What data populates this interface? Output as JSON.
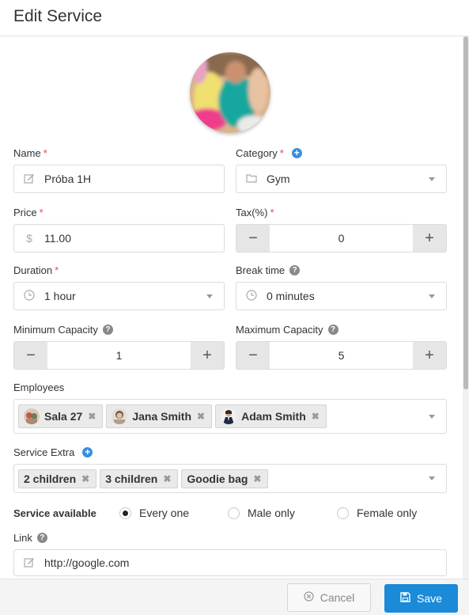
{
  "header": {
    "title": "Edit Service"
  },
  "colors": {
    "accent": "#1a8ad9",
    "required": "#ee4444",
    "help": "#888888"
  },
  "form": {
    "name": {
      "label": "Name",
      "value": "Próba 1H",
      "icon": "edit-icon"
    },
    "category": {
      "label": "Category",
      "value": "Gym",
      "icon": "folder-icon"
    },
    "price": {
      "label": "Price",
      "value": "11.00",
      "prefix": "$"
    },
    "tax": {
      "label": "Tax(%)",
      "value": "0"
    },
    "duration": {
      "label": "Duration",
      "value": "1 hour",
      "icon": "clock-icon"
    },
    "break_time": {
      "label": "Break time",
      "value": "0 minutes",
      "icon": "clock-icon"
    },
    "min_capacity": {
      "label": "Minimum Capacity",
      "value": "1"
    },
    "max_capacity": {
      "label": "Maximum Capacity",
      "value": "5"
    },
    "employees": {
      "label": "Employees",
      "items": [
        {
          "name": "Sala 27"
        },
        {
          "name": "Jana Smith"
        },
        {
          "name": "Adam Smith"
        }
      ]
    },
    "service_extra": {
      "label": "Service Extra",
      "items": [
        {
          "name": "2 children"
        },
        {
          "name": "3 children"
        },
        {
          "name": "Goodie bag"
        }
      ]
    },
    "service_available": {
      "label": "Service available",
      "options": [
        "Every one",
        "Male only",
        "Female only"
      ],
      "selected": "Every one"
    },
    "link": {
      "label": "Link",
      "value": "http://google.com"
    }
  },
  "footer": {
    "cancel_label": "Cancel",
    "save_label": "Save"
  }
}
